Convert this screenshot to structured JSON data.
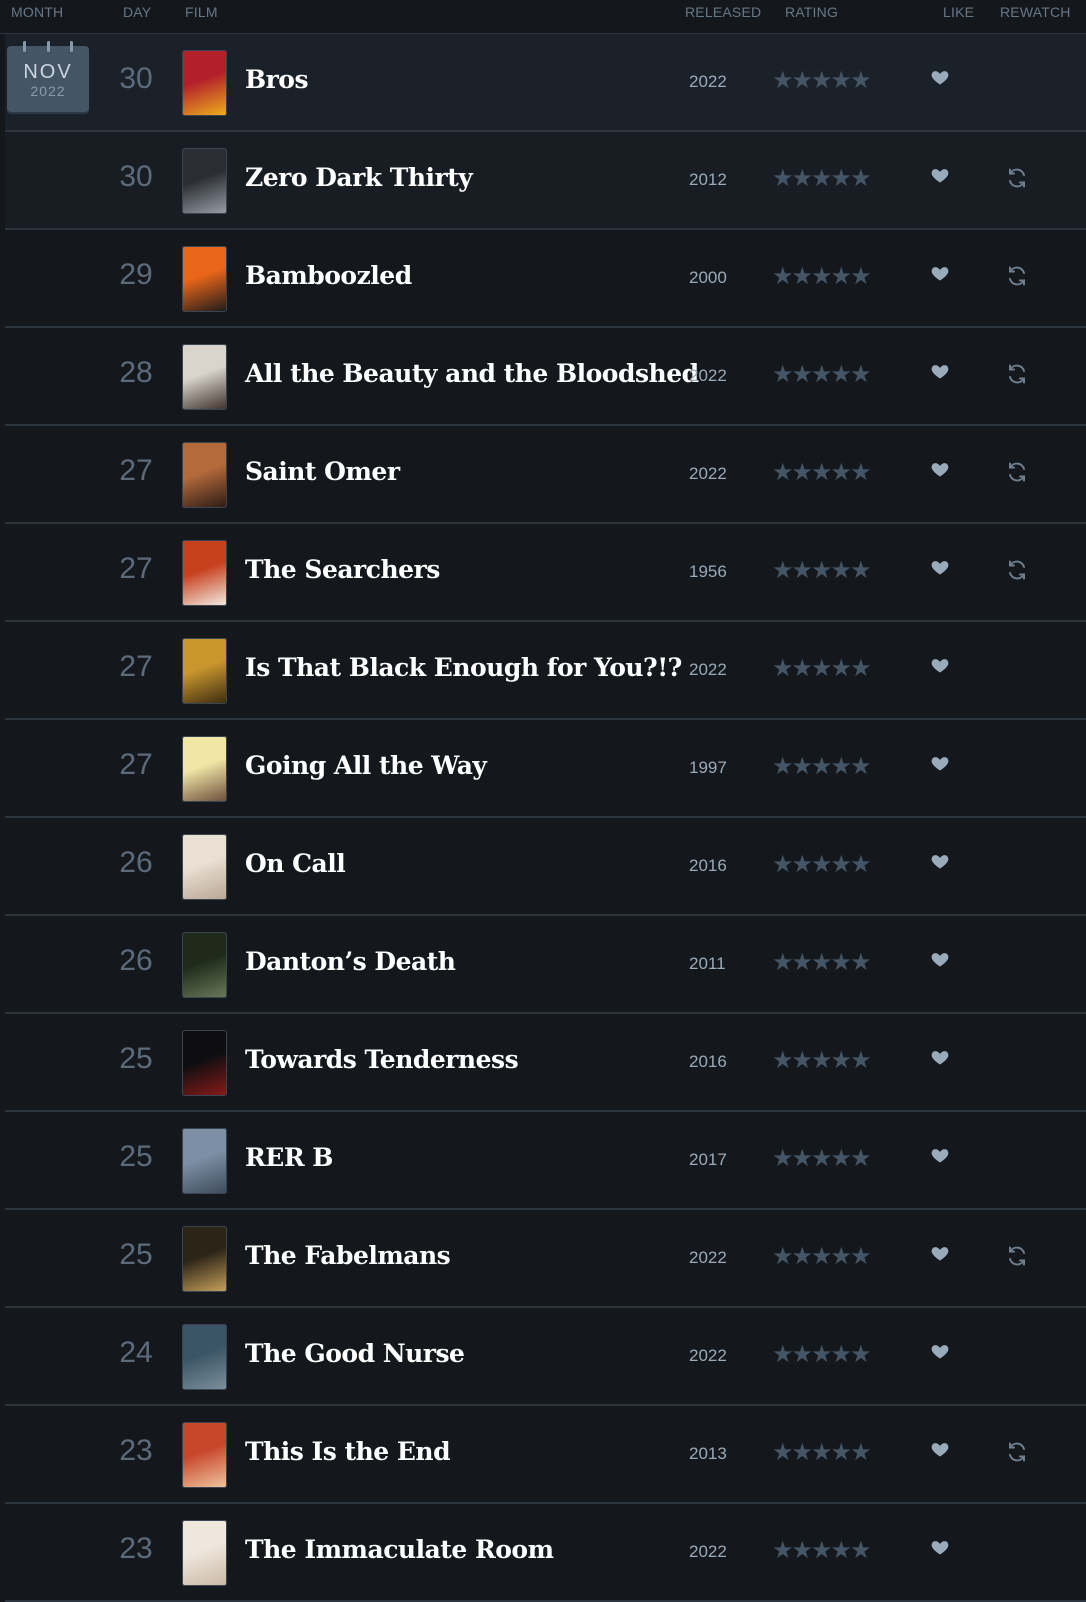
{
  "headers": {
    "month": "MONTH",
    "day": "DAY",
    "film": "FILM",
    "released": "RELEASED",
    "rating": "RATING",
    "like": "LIKE",
    "rewatch": "REWATCH"
  },
  "calendar": {
    "month": "NOV",
    "year": "2022"
  },
  "entries": [
    {
      "day": "30",
      "title": "Bros",
      "year": "2022",
      "stars": "★★★★★",
      "liked": true,
      "rewatch": false,
      "poster": [
        "#b3202a",
        "#f0b21c"
      ]
    },
    {
      "day": "30",
      "title": "Zero Dark Thirty",
      "year": "2012",
      "stars": "★★★★★",
      "liked": true,
      "rewatch": true,
      "poster": [
        "#2a2d33",
        "#9aa0a8"
      ]
    },
    {
      "day": "29",
      "title": "Bamboozled",
      "year": "2000",
      "stars": "★★★★★",
      "liked": true,
      "rewatch": true,
      "poster": [
        "#e8651a",
        "#1a1a1a"
      ]
    },
    {
      "day": "28",
      "title": "All the Beauty and the Bloodshed",
      "year": "2022",
      "stars": "★★★★★",
      "liked": true,
      "rewatch": true,
      "poster": [
        "#d9d4cc",
        "#3a2e28"
      ]
    },
    {
      "day": "27",
      "title": "Saint Omer",
      "year": "2022",
      "stars": "★★★★★",
      "liked": true,
      "rewatch": true,
      "poster": [
        "#b56a3c",
        "#2a1a14"
      ]
    },
    {
      "day": "27",
      "title": "The Searchers",
      "year": "1956",
      "stars": "★★★★★",
      "liked": true,
      "rewatch": true,
      "poster": [
        "#c8411f",
        "#f2efe6"
      ]
    },
    {
      "day": "27",
      "title": "Is That Black Enough for You?!?",
      "year": "2022",
      "stars": "★★★★★",
      "liked": true,
      "rewatch": false,
      "poster": [
        "#c9962e",
        "#3a2a10"
      ]
    },
    {
      "day": "27",
      "title": "Going All the Way",
      "year": "1997",
      "stars": "★★★★★",
      "liked": true,
      "rewatch": false,
      "poster": [
        "#f1e6a6",
        "#6b4c3a"
      ]
    },
    {
      "day": "26",
      "title": "On Call",
      "year": "2016",
      "stars": "★★★★★",
      "liked": true,
      "rewatch": false,
      "poster": [
        "#e9dfd2",
        "#b9a594"
      ]
    },
    {
      "day": "26",
      "title": "Danton’s Death",
      "year": "2011",
      "stars": "★★★★★",
      "liked": true,
      "rewatch": false,
      "poster": [
        "#1f2a1a",
        "#6b7a5a"
      ]
    },
    {
      "day": "25",
      "title": "Towards Tenderness",
      "year": "2016",
      "stars": "★★★★★",
      "liked": true,
      "rewatch": false,
      "poster": [
        "#0e0e10",
        "#8a1a1a"
      ]
    },
    {
      "day": "25",
      "title": "RER B",
      "year": "2017",
      "stars": "★★★★★",
      "liked": true,
      "rewatch": false,
      "poster": [
        "#7d8fa5",
        "#3c4a5a"
      ]
    },
    {
      "day": "25",
      "title": "The Fabelmans",
      "year": "2022",
      "stars": "★★★★★",
      "liked": true,
      "rewatch": true,
      "poster": [
        "#2d2418",
        "#c9a45c"
      ]
    },
    {
      "day": "24",
      "title": "The Good Nurse",
      "year": "2022",
      "stars": "★★★★★",
      "liked": true,
      "rewatch": false,
      "poster": [
        "#3b5566",
        "#7c909c"
      ]
    },
    {
      "day": "23",
      "title": "This Is the End",
      "year": "2013",
      "stars": "★★★★★",
      "liked": true,
      "rewatch": true,
      "poster": [
        "#c8472c",
        "#f0c8a0"
      ]
    },
    {
      "day": "23",
      "title": "The Immaculate Room",
      "year": "2022",
      "stars": "★★★★★",
      "liked": true,
      "rewatch": false,
      "poster": [
        "#efe7dd",
        "#c9b7a4"
      ]
    }
  ],
  "colors": {
    "background": "#14181c",
    "title": "#ffffff",
    "muted": "#99aabb",
    "icon": "#99aabb",
    "star_empty": "#445566"
  }
}
